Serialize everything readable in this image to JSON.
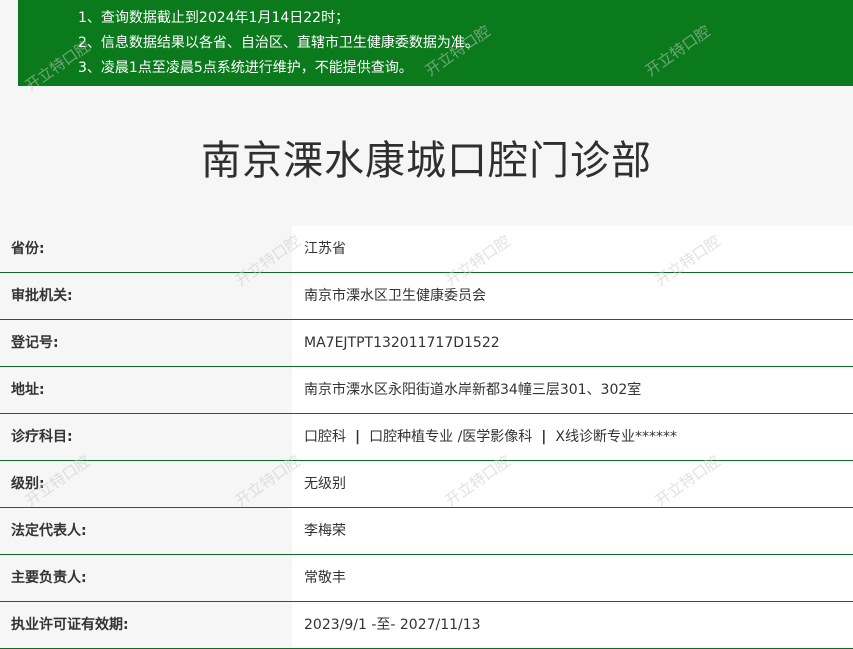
{
  "notice": {
    "lines": [
      "1、查询数据截止到2024年1月14日22时；",
      "2、信息数据结果以各省、自治区、直辖市卫生健康委数据为准。",
      "3、凌晨1点至凌晨5点系统进行维护，不能提供查询。"
    ]
  },
  "title": "南京溧水康城口腔门诊部",
  "rows": [
    {
      "label": "省份:",
      "value": "江苏省"
    },
    {
      "label": "审批机关:",
      "value": "南京市溧水区卫生健康委员会"
    },
    {
      "label": "登记号:",
      "value": "MA7EJTPT132011717D1522"
    },
    {
      "label": "地址:",
      "value": "南京市溧水区永阳街道水岸新都34幢三层301、302室"
    },
    {
      "label": "诊疗科目:",
      "subjects": [
        "口腔科",
        "口腔种植专业 /医学影像科",
        "X线诊断专业******"
      ],
      "separator": "|"
    },
    {
      "label": "级别:",
      "value": "无级别"
    },
    {
      "label": "法定代表人:",
      "value": "李梅荣"
    },
    {
      "label": "主要负责人:",
      "value": "常敬丰"
    },
    {
      "label": "执业许可证有效期:",
      "value": "2023/9/1 -至- 2027/11/13"
    }
  ],
  "watermark": "开立特口腔",
  "colors": {
    "notice_bg": "#0a7a1c",
    "row_border": "#0d6b2a"
  }
}
